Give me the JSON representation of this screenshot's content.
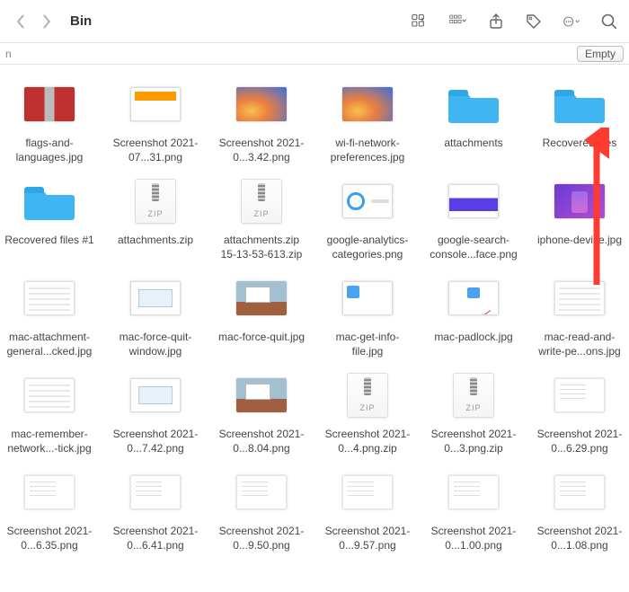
{
  "window": {
    "title": "Bin",
    "pathbar_text": "n",
    "empty_button": "Empty"
  },
  "items": [
    {
      "name": "flags-and-languages.jpg",
      "kind": "thumb",
      "look": "t-flags"
    },
    {
      "name": "Screenshot 2021-07...31.png",
      "kind": "thumb",
      "look": "t-shot1"
    },
    {
      "name": "Screenshot 2021-0...3.42.png",
      "kind": "thumb",
      "look": "t-wp"
    },
    {
      "name": "wi-fi-network-preferences.jpg",
      "kind": "thumb",
      "look": "t-wp"
    },
    {
      "name": "attachments",
      "kind": "folder"
    },
    {
      "name": "Recovered files",
      "kind": "folder"
    },
    {
      "name": "Recovered files #1",
      "kind": "folder"
    },
    {
      "name": "attachments.zip",
      "kind": "zip"
    },
    {
      "name": "attachments.zip 15-13-53-613.zip",
      "kind": "zip"
    },
    {
      "name": "google-analytics-categories.png",
      "kind": "thumb",
      "look": "t-shot-ga"
    },
    {
      "name": "google-search-console...face.png",
      "kind": "thumb",
      "look": "t-shot-gsc"
    },
    {
      "name": "iphone-device.jpg",
      "kind": "thumb",
      "look": "t-iphone"
    },
    {
      "name": "mac-attachment-general...cked.jpg",
      "kind": "thumb",
      "look": "t-mac-generic"
    },
    {
      "name": "mac-force-quit-window.jpg",
      "kind": "thumb",
      "look": "t-mac-dlg"
    },
    {
      "name": "mac-force-quit.jpg",
      "kind": "thumb",
      "look": "t-mac-outdoor"
    },
    {
      "name": "mac-get-info-file.jpg",
      "kind": "thumb",
      "look": "t-mac-getinfo"
    },
    {
      "name": "mac-padlock.jpg",
      "kind": "thumb",
      "look": "t-mac-padlock"
    },
    {
      "name": "mac-read-and-write-pe...ons.jpg",
      "kind": "thumb",
      "look": "t-mac-generic"
    },
    {
      "name": "mac-remember-network...-tick.jpg",
      "kind": "thumb",
      "look": "t-mac-generic"
    },
    {
      "name": "Screenshot 2021-0...7.42.png",
      "kind": "thumb",
      "look": "t-mac-dlg"
    },
    {
      "name": "Screenshot 2021-0...8.04.png",
      "kind": "thumb",
      "look": "t-mac-outdoor"
    },
    {
      "name": "Screenshot 2021-0...4.png.zip",
      "kind": "zip"
    },
    {
      "name": "Screenshot 2021-0...3.png.zip",
      "kind": "zip"
    },
    {
      "name": "Screenshot 2021-0...6.29.png",
      "kind": "thumb",
      "look": "t-docplain"
    },
    {
      "name": "Screenshot 2021-0...6.35.png",
      "kind": "thumb",
      "look": "t-docplain"
    },
    {
      "name": "Screenshot 2021-0...6.41.png",
      "kind": "thumb",
      "look": "t-docplain"
    },
    {
      "name": "Screenshot 2021-0...9.50.png",
      "kind": "thumb",
      "look": "t-docplain"
    },
    {
      "name": "Screenshot 2021-0...9.57.png",
      "kind": "thumb",
      "look": "t-docplain"
    },
    {
      "name": "Screenshot 2021-0...1.00.png",
      "kind": "thumb",
      "look": "t-docplain"
    },
    {
      "name": "Screenshot 2021-0...1.08.png",
      "kind": "thumb",
      "look": "t-docplain"
    }
  ]
}
